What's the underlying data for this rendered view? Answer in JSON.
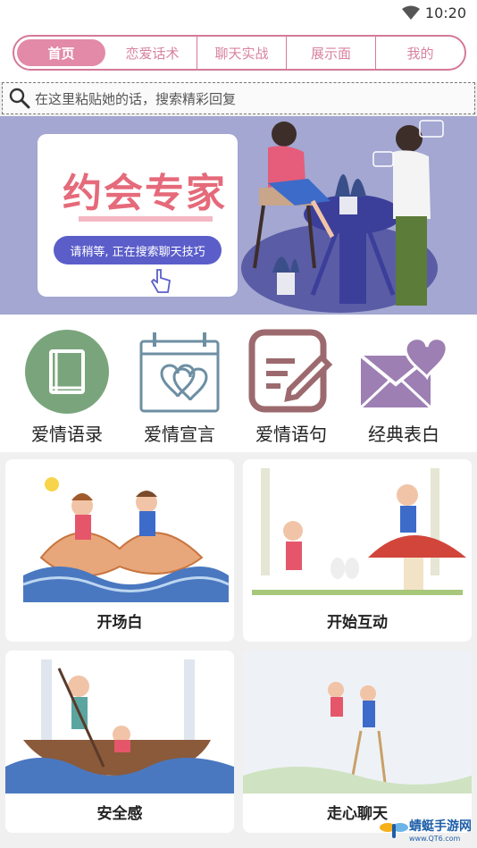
{
  "status": {
    "time": "10:20"
  },
  "tabs": [
    {
      "label": "首页",
      "active": true
    },
    {
      "label": "恋爱话术"
    },
    {
      "label": "聊天实战"
    },
    {
      "label": "展示面"
    },
    {
      "label": "我的"
    }
  ],
  "search": {
    "placeholder": "在这里粘贴她的话，搜索精彩回复"
  },
  "banner": {
    "title": "约会专家",
    "subtitle": "请稍等, 正在搜索聊天技巧"
  },
  "categories": [
    {
      "label": "爱情语录",
      "icon": "book-icon",
      "color": "#7aa57c"
    },
    {
      "label": "爱情宣言",
      "icon": "calendar-hearts-icon",
      "color": "#6d8fa3"
    },
    {
      "label": "爱情语句",
      "icon": "edit-note-icon",
      "color": "#9c6a6e"
    },
    {
      "label": "经典表白",
      "icon": "love-letter-icon",
      "color": "#9d7fb3"
    }
  ],
  "cards": [
    {
      "label": "开场白"
    },
    {
      "label": "开始互动"
    },
    {
      "label": "安全感"
    },
    {
      "label": "走心聊天"
    }
  ],
  "watermark": {
    "name": "蜻蜓手游网",
    "url": "www.QT6.com"
  }
}
